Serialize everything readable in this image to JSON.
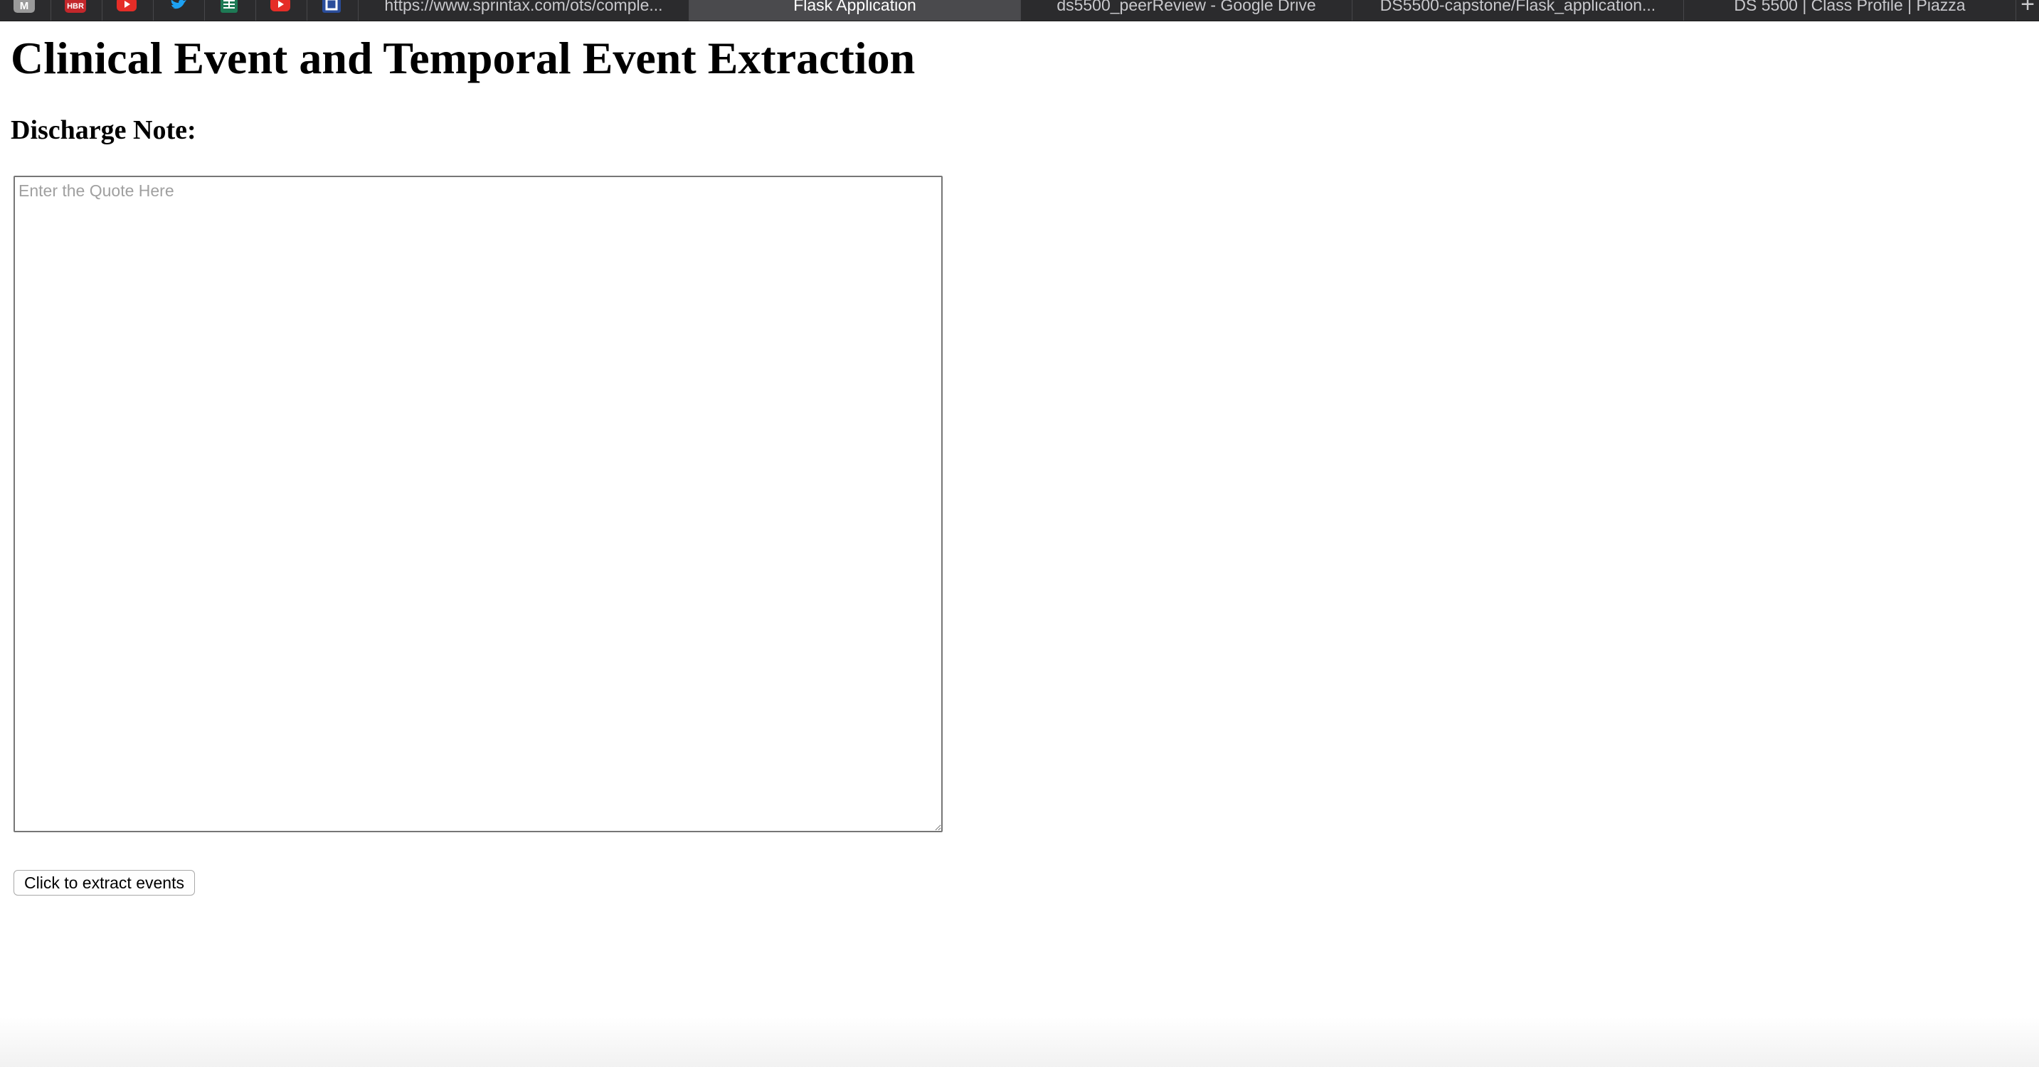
{
  "browser": {
    "pinned_tabs": [
      {
        "icon": "gmail-icon",
        "label": "M",
        "color": "#9a9a9a"
      },
      {
        "icon": "hbr-icon",
        "label": "HBR",
        "color": "#c3272b"
      },
      {
        "icon": "youtube-icon",
        "label": "",
        "color": "#e52d27"
      },
      {
        "icon": "twitter-icon",
        "label": "",
        "color": "#1da1f2"
      },
      {
        "icon": "sheets-icon",
        "label": "",
        "color": "#1e7a55"
      },
      {
        "icon": "youtube-icon",
        "label": "",
        "color": "#e52d27"
      },
      {
        "icon": "app-icon",
        "label": "",
        "color": "#2a4d9b"
      }
    ],
    "tabs": [
      {
        "label": "https://www.sprintax.com/ots/comple..."
      },
      {
        "label": "Flask Application",
        "active": true
      },
      {
        "label": "ds5500_peerReview - Google Drive"
      },
      {
        "label": "DS5500-capstone/Flask_application..."
      },
      {
        "label": "DS 5500 | Class Profile | Piazza"
      }
    ],
    "new_tab_symbol": "+"
  },
  "page": {
    "title": "Clinical Event and Temporal Event Extraction",
    "note_label": "Discharge Note:",
    "quote_input": {
      "value": "",
      "placeholder": "Enter the Quote Here"
    },
    "extract_button_label": "Click to extract events"
  }
}
